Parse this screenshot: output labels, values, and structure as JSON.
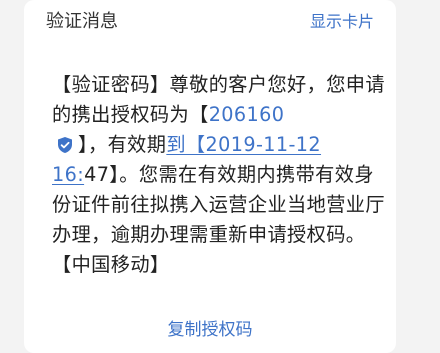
{
  "header": {
    "title": "验证消息",
    "action_label": "显示卡片"
  },
  "message": {
    "prefix": "【验证密码】尊敬的客户您好，您申请的携出授权码为【",
    "auth_code": "206160",
    "after_code": "】，有效期",
    "date_part1": "到【2019-11-12",
    "date_part2": "16:",
    "date_after_link": "47】。您需在有效期内携带有效身份证件前往拟携入运营企业当地营业厅办理，逾期办理需重新申请授权码。【中国移动】"
  },
  "footer": {
    "copy_label": "复制授权码"
  },
  "colors": {
    "link": "#3e73c8",
    "background": "#f3f3f3",
    "card": "#ffffff"
  },
  "icons": {
    "verified": "shield-check-icon"
  }
}
